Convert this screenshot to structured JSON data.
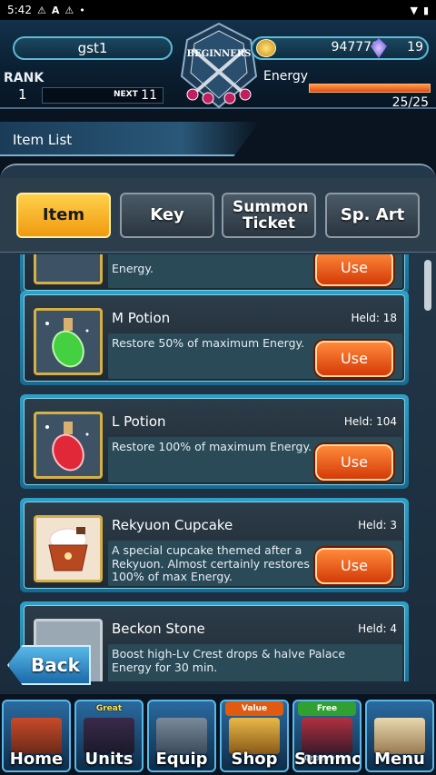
{
  "status_bar": {
    "time": "5:42",
    "icons_left": [
      "warning-icon",
      "a-icon",
      "warning-icon",
      "dot-icon"
    ],
    "icons_right": [
      "wifi-icon",
      "battery-icon"
    ]
  },
  "header": {
    "player_name": "gst1",
    "emblem_text": "BEGINNERS",
    "coins": "947770",
    "gems": "19",
    "rank_label": "RANK",
    "rank": "1",
    "next_label": "NEXT",
    "next_value": "11",
    "energy_label": "Energy",
    "energy_text": "25/25",
    "energy_fraction": 1.0
  },
  "section_title": "Item List",
  "tabs": [
    {
      "label": "Item",
      "active": true
    },
    {
      "label": "Key",
      "active": false
    },
    {
      "label": "Summon Ticket",
      "active": false
    },
    {
      "label": "Sp. Art",
      "active": false
    }
  ],
  "items": [
    {
      "name": "",
      "held": "",
      "desc": "Energy.",
      "use": "Use",
      "partial": true
    },
    {
      "name": "M Potion",
      "held": "Held: 18",
      "desc": "Restore 50% of maximum Energy.",
      "use": "Use"
    },
    {
      "name": "L Potion",
      "held": "Held: 104",
      "desc": "Restore 100% of maximum Energy.",
      "use": "Use"
    },
    {
      "name": "Rekyuon Cupcake",
      "held": "Held: 3",
      "desc": "A special cupcake themed after a Rekyuon. Almost certainly restores 100% of max Energy.",
      "use": "Use"
    },
    {
      "name": "Beckon Stone",
      "held": "Held: 4",
      "desc": "Boost high-Lv Crest drops & halve Palace Energy for 30 min.",
      "use": ""
    }
  ],
  "back_label": "Back",
  "bottom_nav": [
    {
      "label": "Home",
      "badge": ""
    },
    {
      "label": "Units",
      "badge": "Great Success Rate UP"
    },
    {
      "label": "Equip",
      "badge": ""
    },
    {
      "label": "Shop",
      "badge": "Value Bundle"
    },
    {
      "label": "Summon",
      "badge": "Free Summon",
      "sub": "Crossover"
    },
    {
      "label": "Menu",
      "badge": ""
    }
  ],
  "colors": {
    "accent": "#2ea0c8",
    "use_button": "#e85a18",
    "tab_active": "#f0b020"
  }
}
